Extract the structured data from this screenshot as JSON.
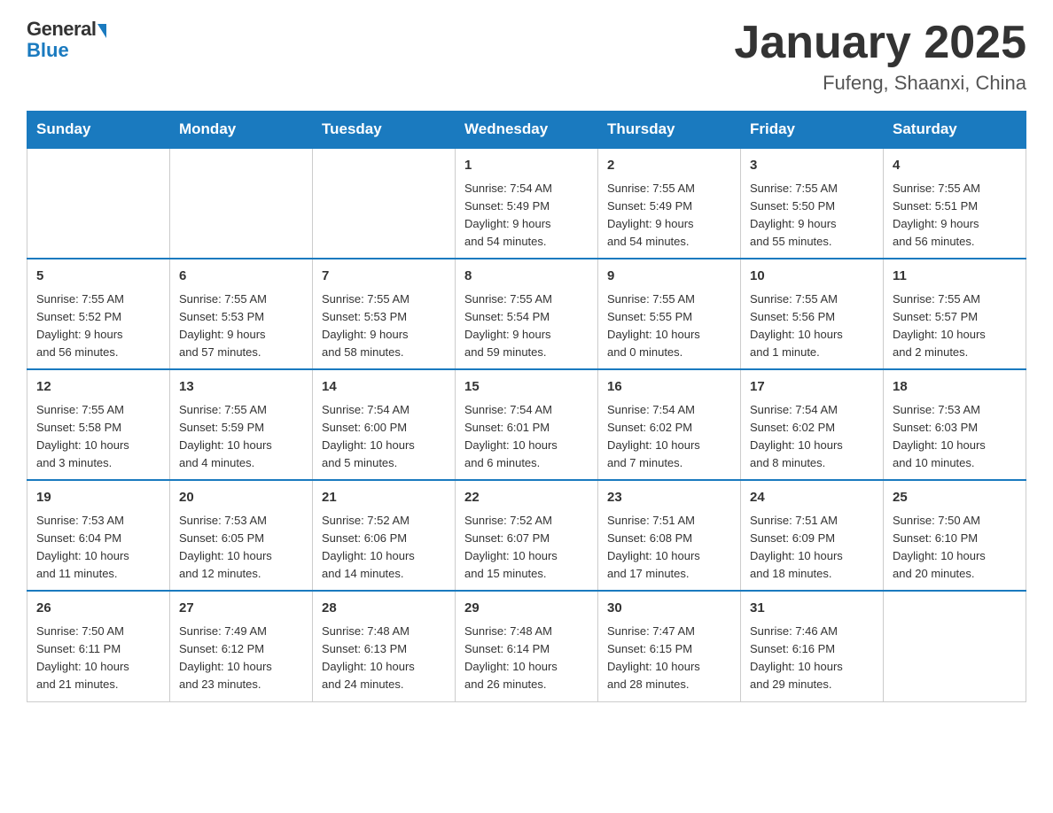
{
  "header": {
    "logo_general": "General",
    "logo_blue": "Blue",
    "month_title": "January 2025",
    "location": "Fufeng, Shaanxi, China"
  },
  "days_of_week": [
    "Sunday",
    "Monday",
    "Tuesday",
    "Wednesday",
    "Thursday",
    "Friday",
    "Saturday"
  ],
  "weeks": [
    [
      {
        "day": "",
        "info": ""
      },
      {
        "day": "",
        "info": ""
      },
      {
        "day": "",
        "info": ""
      },
      {
        "day": "1",
        "info": "Sunrise: 7:54 AM\nSunset: 5:49 PM\nDaylight: 9 hours\nand 54 minutes."
      },
      {
        "day": "2",
        "info": "Sunrise: 7:55 AM\nSunset: 5:49 PM\nDaylight: 9 hours\nand 54 minutes."
      },
      {
        "day": "3",
        "info": "Sunrise: 7:55 AM\nSunset: 5:50 PM\nDaylight: 9 hours\nand 55 minutes."
      },
      {
        "day": "4",
        "info": "Sunrise: 7:55 AM\nSunset: 5:51 PM\nDaylight: 9 hours\nand 56 minutes."
      }
    ],
    [
      {
        "day": "5",
        "info": "Sunrise: 7:55 AM\nSunset: 5:52 PM\nDaylight: 9 hours\nand 56 minutes."
      },
      {
        "day": "6",
        "info": "Sunrise: 7:55 AM\nSunset: 5:53 PM\nDaylight: 9 hours\nand 57 minutes."
      },
      {
        "day": "7",
        "info": "Sunrise: 7:55 AM\nSunset: 5:53 PM\nDaylight: 9 hours\nand 58 minutes."
      },
      {
        "day": "8",
        "info": "Sunrise: 7:55 AM\nSunset: 5:54 PM\nDaylight: 9 hours\nand 59 minutes."
      },
      {
        "day": "9",
        "info": "Sunrise: 7:55 AM\nSunset: 5:55 PM\nDaylight: 10 hours\nand 0 minutes."
      },
      {
        "day": "10",
        "info": "Sunrise: 7:55 AM\nSunset: 5:56 PM\nDaylight: 10 hours\nand 1 minute."
      },
      {
        "day": "11",
        "info": "Sunrise: 7:55 AM\nSunset: 5:57 PM\nDaylight: 10 hours\nand 2 minutes."
      }
    ],
    [
      {
        "day": "12",
        "info": "Sunrise: 7:55 AM\nSunset: 5:58 PM\nDaylight: 10 hours\nand 3 minutes."
      },
      {
        "day": "13",
        "info": "Sunrise: 7:55 AM\nSunset: 5:59 PM\nDaylight: 10 hours\nand 4 minutes."
      },
      {
        "day": "14",
        "info": "Sunrise: 7:54 AM\nSunset: 6:00 PM\nDaylight: 10 hours\nand 5 minutes."
      },
      {
        "day": "15",
        "info": "Sunrise: 7:54 AM\nSunset: 6:01 PM\nDaylight: 10 hours\nand 6 minutes."
      },
      {
        "day": "16",
        "info": "Sunrise: 7:54 AM\nSunset: 6:02 PM\nDaylight: 10 hours\nand 7 minutes."
      },
      {
        "day": "17",
        "info": "Sunrise: 7:54 AM\nSunset: 6:02 PM\nDaylight: 10 hours\nand 8 minutes."
      },
      {
        "day": "18",
        "info": "Sunrise: 7:53 AM\nSunset: 6:03 PM\nDaylight: 10 hours\nand 10 minutes."
      }
    ],
    [
      {
        "day": "19",
        "info": "Sunrise: 7:53 AM\nSunset: 6:04 PM\nDaylight: 10 hours\nand 11 minutes."
      },
      {
        "day": "20",
        "info": "Sunrise: 7:53 AM\nSunset: 6:05 PM\nDaylight: 10 hours\nand 12 minutes."
      },
      {
        "day": "21",
        "info": "Sunrise: 7:52 AM\nSunset: 6:06 PM\nDaylight: 10 hours\nand 14 minutes."
      },
      {
        "day": "22",
        "info": "Sunrise: 7:52 AM\nSunset: 6:07 PM\nDaylight: 10 hours\nand 15 minutes."
      },
      {
        "day": "23",
        "info": "Sunrise: 7:51 AM\nSunset: 6:08 PM\nDaylight: 10 hours\nand 17 minutes."
      },
      {
        "day": "24",
        "info": "Sunrise: 7:51 AM\nSunset: 6:09 PM\nDaylight: 10 hours\nand 18 minutes."
      },
      {
        "day": "25",
        "info": "Sunrise: 7:50 AM\nSunset: 6:10 PM\nDaylight: 10 hours\nand 20 minutes."
      }
    ],
    [
      {
        "day": "26",
        "info": "Sunrise: 7:50 AM\nSunset: 6:11 PM\nDaylight: 10 hours\nand 21 minutes."
      },
      {
        "day": "27",
        "info": "Sunrise: 7:49 AM\nSunset: 6:12 PM\nDaylight: 10 hours\nand 23 minutes."
      },
      {
        "day": "28",
        "info": "Sunrise: 7:48 AM\nSunset: 6:13 PM\nDaylight: 10 hours\nand 24 minutes."
      },
      {
        "day": "29",
        "info": "Sunrise: 7:48 AM\nSunset: 6:14 PM\nDaylight: 10 hours\nand 26 minutes."
      },
      {
        "day": "30",
        "info": "Sunrise: 7:47 AM\nSunset: 6:15 PM\nDaylight: 10 hours\nand 28 minutes."
      },
      {
        "day": "31",
        "info": "Sunrise: 7:46 AM\nSunset: 6:16 PM\nDaylight: 10 hours\nand 29 minutes."
      },
      {
        "day": "",
        "info": ""
      }
    ]
  ]
}
